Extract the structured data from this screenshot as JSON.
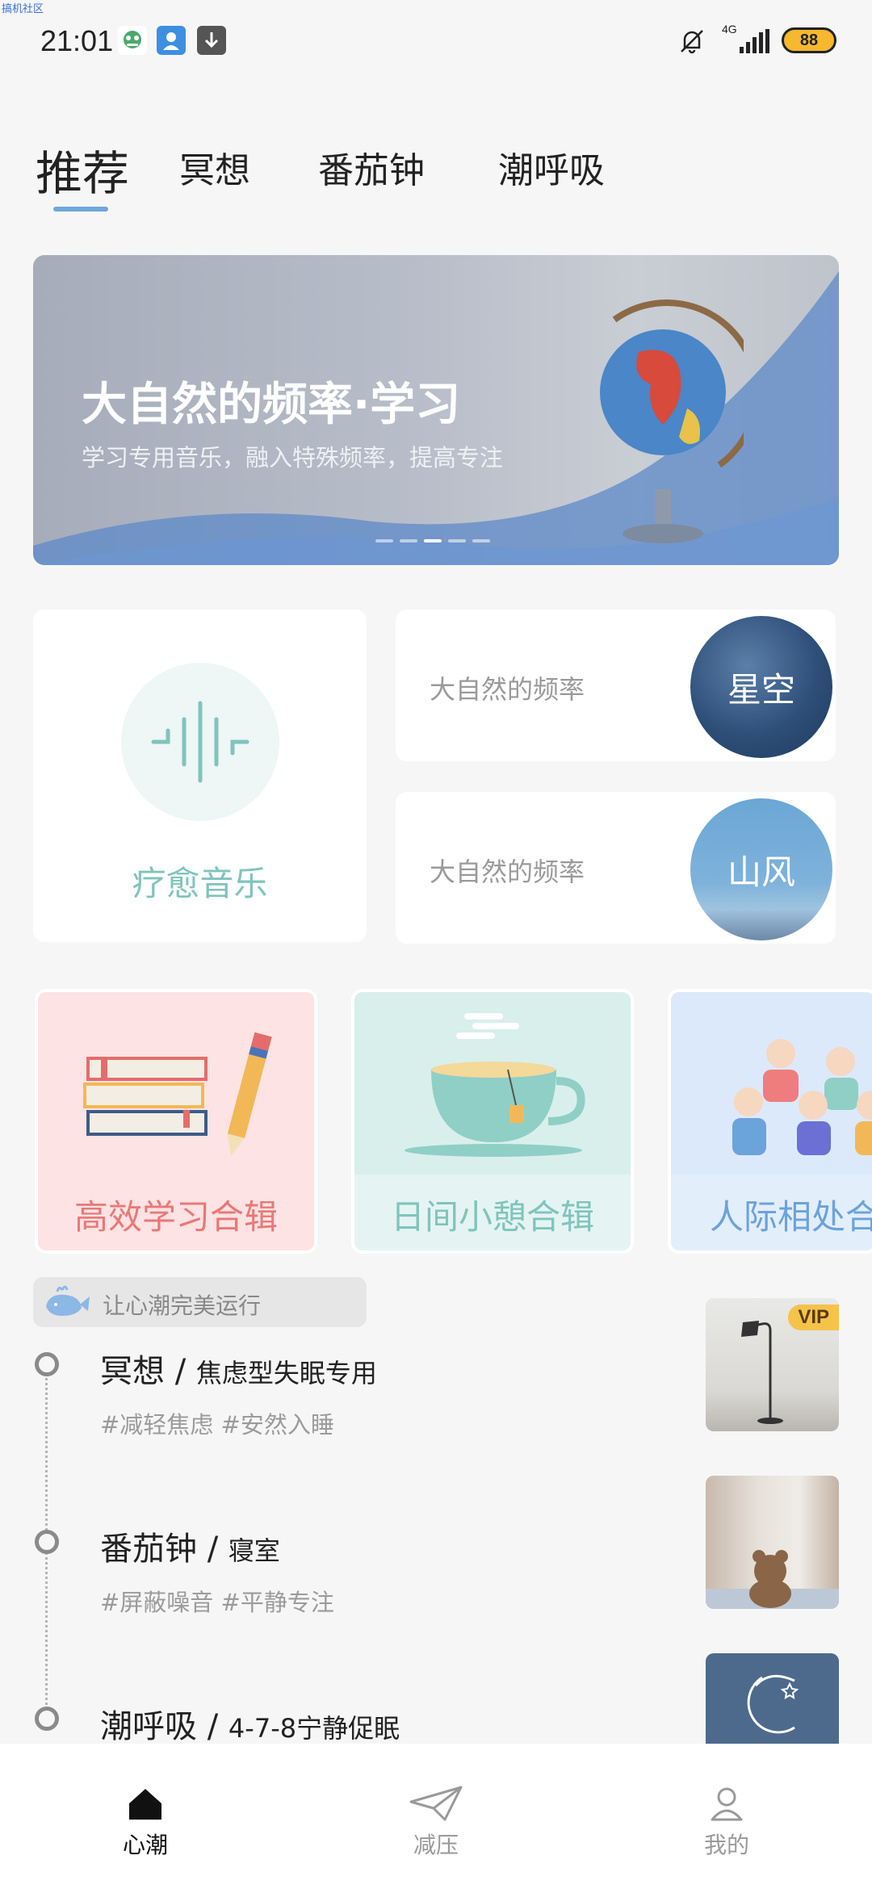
{
  "watermark": "搞机社区",
  "status_bar": {
    "time": "21:01",
    "network": "4G",
    "battery": "88",
    "icons": [
      "app-notification-icon",
      "app-notification-icon",
      "download-icon",
      "mute-bell-icon",
      "signal-icon",
      "battery-icon"
    ]
  },
  "tabs": [
    {
      "label": "推荐",
      "active": true
    },
    {
      "label": "冥想",
      "active": false
    },
    {
      "label": "番茄钟",
      "active": false
    },
    {
      "label": "潮呼吸",
      "active": false
    }
  ],
  "banner": {
    "title": "大自然的频率·学习",
    "subtitle": "学习专用音乐，融入特殊频率，提高专注",
    "page_count": 5,
    "active_page": 3
  },
  "healing_card": {
    "label": "疗愈音乐",
    "icon": "sound-wave-icon"
  },
  "frequency_cards": [
    {
      "label": "大自然的频率",
      "badge": "星空"
    },
    {
      "label": "大自然的频率",
      "badge": "山风"
    }
  ],
  "collections": [
    {
      "label": "高效学习合辑",
      "color": "#e97878",
      "bg": "#fde3e3"
    },
    {
      "label": "日间小憩合辑",
      "color": "#7fc4bd",
      "bg": "#e5f4f2"
    },
    {
      "label": "人际相处合辑",
      "color": "#6ba3db",
      "bg": "#e3eefb"
    }
  ],
  "timeline": {
    "header": "让心潮完美运行",
    "items": [
      {
        "title": "冥想",
        "subtitle": "焦虑型失眠专用",
        "tags": "#减轻焦虑  #安然入睡",
        "vip": "VIP"
      },
      {
        "title": "番茄钟",
        "subtitle": "寝室",
        "tags": "#屏蔽噪音  #平静专注"
      },
      {
        "title": "潮呼吸",
        "subtitle": "4-7-8宁静促眠",
        "tags": ""
      }
    ],
    "separator": "/"
  },
  "bottom_nav": [
    {
      "label": "心潮",
      "icon": "home-icon",
      "active": true
    },
    {
      "label": "减压",
      "icon": "paper-plane-icon",
      "active": false
    },
    {
      "label": "我的",
      "icon": "profile-icon",
      "active": false
    }
  ]
}
